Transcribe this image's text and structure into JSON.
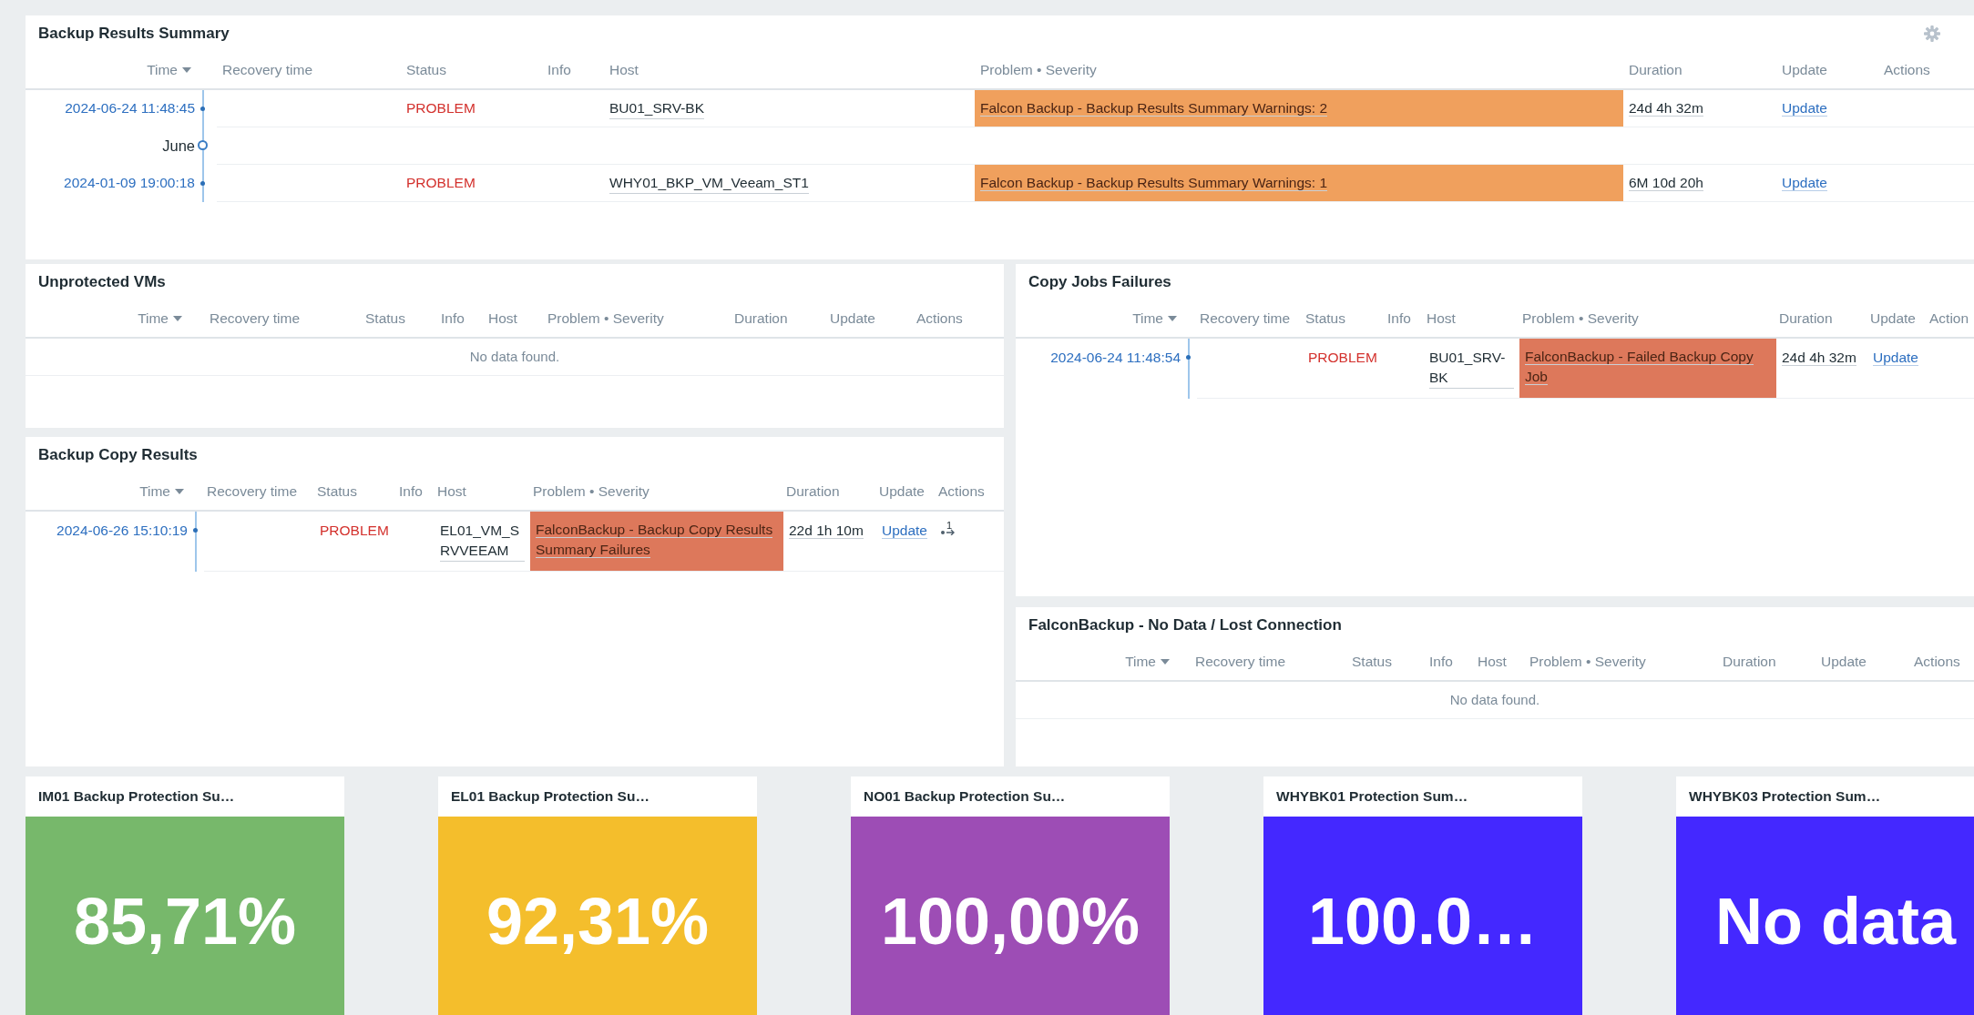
{
  "panels": [
    {
      "title": "Backup Results Summary",
      "columns": [
        {
          "label": "Time",
          "sorted": true
        },
        {
          "label": "Recovery time",
          "sorted": false
        },
        {
          "label": "Status",
          "sorted": false
        },
        {
          "label": "Info",
          "sorted": false
        },
        {
          "label": "Host",
          "sorted": false
        },
        {
          "label": "Problem • Severity",
          "sorted": false
        },
        {
          "label": "Duration",
          "sorted": false
        },
        {
          "label": "Update",
          "sorted": false
        },
        {
          "label": "Actions",
          "sorted": false
        }
      ],
      "rows": [
        {
          "kind": "event",
          "time": "2024-06-24 11:48:45",
          "status": "PROBLEM",
          "host": "BU01_SRV-BK",
          "problem": "Falcon Backup - Backup Results Summary Warnings: 2",
          "color": "#f0a05d",
          "duration": "24d 4h 32m",
          "update": "Update"
        },
        {
          "kind": "month",
          "label": "June"
        },
        {
          "kind": "event",
          "time": "2024-01-09 19:00:18",
          "status": "PROBLEM",
          "host": "WHY01_BKP_VM_Veeam_ST1",
          "problem": "Falcon Backup - Backup Results Summary Warnings: 1",
          "color": "#f0a05d",
          "duration": "6M 10d 20h",
          "update": "Update"
        }
      ]
    },
    {
      "title": "Unprotected VMs",
      "columns": [
        {
          "label": "Time",
          "sorted": true
        },
        {
          "label": "Recovery time",
          "sorted": false
        },
        {
          "label": "Status",
          "sorted": false
        },
        {
          "label": "Info",
          "sorted": false
        },
        {
          "label": "Host",
          "sorted": false
        },
        {
          "label": "Problem • Severity",
          "sorted": false
        },
        {
          "label": "Duration",
          "sorted": false
        },
        {
          "label": "Update",
          "sorted": false
        },
        {
          "label": "Actions",
          "sorted": false
        }
      ],
      "empty_text": "No data found."
    },
    {
      "title": "Copy Jobs Failures",
      "columns": [
        {
          "label": "Time",
          "sorted": true
        },
        {
          "label": "Recovery time",
          "sorted": false
        },
        {
          "label": "Status",
          "sorted": false
        },
        {
          "label": "Info",
          "sorted": false
        },
        {
          "label": "Host",
          "sorted": false
        },
        {
          "label": "Problem • Severity",
          "sorted": false
        },
        {
          "label": "Duration",
          "sorted": false
        },
        {
          "label": "Update",
          "sorted": false
        },
        {
          "label": "Action",
          "sorted": false
        }
      ],
      "rows": [
        {
          "kind": "event",
          "time": "2024-06-24 11:48:54",
          "status": "PROBLEM",
          "host": "BU01_SRV-BK",
          "problem": "FalconBackup - Failed Backup Copy Job",
          "color": "#dd785b",
          "duration": "24d 4h 32m",
          "update": "Update"
        }
      ]
    },
    {
      "title": "Backup Copy Results",
      "columns": [
        {
          "label": "Time",
          "sorted": true
        },
        {
          "label": "Recovery time",
          "sorted": false
        },
        {
          "label": "Status",
          "sorted": false
        },
        {
          "label": "Info",
          "sorted": false
        },
        {
          "label": "Host",
          "sorted": false
        },
        {
          "label": "Problem • Severity",
          "sorted": false
        },
        {
          "label": "Duration",
          "sorted": false
        },
        {
          "label": "Update",
          "sorted": false
        },
        {
          "label": "Actions",
          "sorted": false
        }
      ],
      "rows": [
        {
          "kind": "event",
          "time": "2024-06-26 15:10:19",
          "status": "PROBLEM",
          "host": "EL01_VM_SRVVEEAM",
          "problem": "FalconBackup - Backup Copy Results Summary Failures",
          "color": "#dd785b",
          "duration": "22d 1h 10m",
          "update": "Update",
          "actions": "1"
        }
      ]
    },
    {
      "title": "FalconBackup - No Data / Lost Connection",
      "columns": [
        {
          "label": "Time",
          "sorted": true
        },
        {
          "label": "Recovery time",
          "sorted": false
        },
        {
          "label": "Status",
          "sorted": false
        },
        {
          "label": "Info",
          "sorted": false
        },
        {
          "label": "Host",
          "sorted": false
        },
        {
          "label": "Problem • Severity",
          "sorted": false
        },
        {
          "label": "Duration",
          "sorted": false
        },
        {
          "label": "Update",
          "sorted": false
        },
        {
          "label": "Actions",
          "sorted": false
        }
      ],
      "empty_text": "No data found."
    }
  ],
  "tiles": [
    {
      "title": "IM01 Backup Protection Su…",
      "value": "85,71%",
      "color": "#77b86b"
    },
    {
      "title": "EL01 Backup Protection Su…",
      "value": "92,31%",
      "color": "#f4be2c"
    },
    {
      "title": "NO01 Backup Protection Su…",
      "value": "100,00%",
      "color": "#9d4db5"
    },
    {
      "title": "WHYBK01 Protection Sum…",
      "value": "100.0…",
      "color": "#4428ff"
    },
    {
      "title": "WHYBK03 Protection Sum…",
      "value": "No data",
      "color": "#4428ff"
    }
  ]
}
